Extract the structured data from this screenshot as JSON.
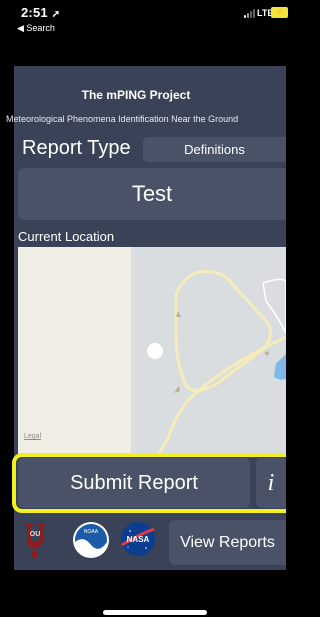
{
  "status_bar": {
    "time": "2:51",
    "location_glyph": "➚",
    "back_label": "◀ Search",
    "carrier": "LTE",
    "battery_label": "⚡"
  },
  "app": {
    "title": "The mPING Project",
    "subtitle": "Meteorological Phenomena Identification Near the Ground",
    "report_type_label": "Report Type",
    "definitions_button": "Definitions",
    "selected_report_type": "Test",
    "current_location_label": "Current Location",
    "map_legal": "Legal",
    "submit_button": "Submit Report",
    "info_button": "i",
    "view_reports_button": "View Reports"
  },
  "logos": {
    "ou": "OU",
    "noaa": "NOAA",
    "nasa": "NASA"
  },
  "colors": {
    "panel": "#3a4257",
    "button": "#4a5268",
    "highlight": "#f4ef22",
    "map_road": "#f5ecb8"
  }
}
